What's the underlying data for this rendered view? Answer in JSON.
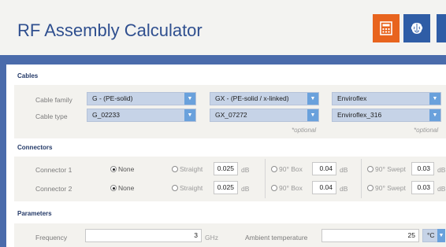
{
  "app": {
    "title": "RF Assembly Calculator"
  },
  "header": {
    "buttons": [
      {
        "icon": "calculator-icon"
      },
      {
        "icon": "brain-icon"
      }
    ]
  },
  "cables": {
    "heading": "Cables",
    "family_label": "Cable family",
    "type_label": "Cable type",
    "columns": [
      {
        "family": "G - (PE-solid)",
        "type": "G_02233",
        "optional": ""
      },
      {
        "family": "GX - (PE-solid / x-linked)",
        "type": "GX_07272",
        "optional": "*optional"
      },
      {
        "family": "Enviroflex",
        "type": "Enviroflex_316",
        "optional": "*optional"
      }
    ]
  },
  "connectors": {
    "heading": "Connectors",
    "rows": [
      {
        "label": "Connector 1",
        "none": "None",
        "straight": "Straight",
        "straight_val": "0.025",
        "box": "90° Box",
        "box_val": "0.04",
        "swept": "90° Swept",
        "swept_val": "0.03",
        "unit": "dB",
        "selected": "none"
      },
      {
        "label": "Connector 2",
        "none": "None",
        "straight": "Straight",
        "straight_val": "0.025",
        "box": "90° Box",
        "box_val": "0.04",
        "swept": "90° Swept",
        "swept_val": "0.03",
        "unit": "dB",
        "selected": "none"
      }
    ]
  },
  "parameters": {
    "heading": "Parameters",
    "frequency_label": "Frequency",
    "frequency_value": "3",
    "frequency_unit": "GHz",
    "temp_label": "Ambient temperature",
    "temp_value": "25",
    "temp_unit": "°C"
  },
  "colors": {
    "accent_orange": "#e8641e",
    "brand_blue": "#2f5da6",
    "select_bg": "#c6d3e7",
    "select_arrow": "#6aa1dc"
  }
}
